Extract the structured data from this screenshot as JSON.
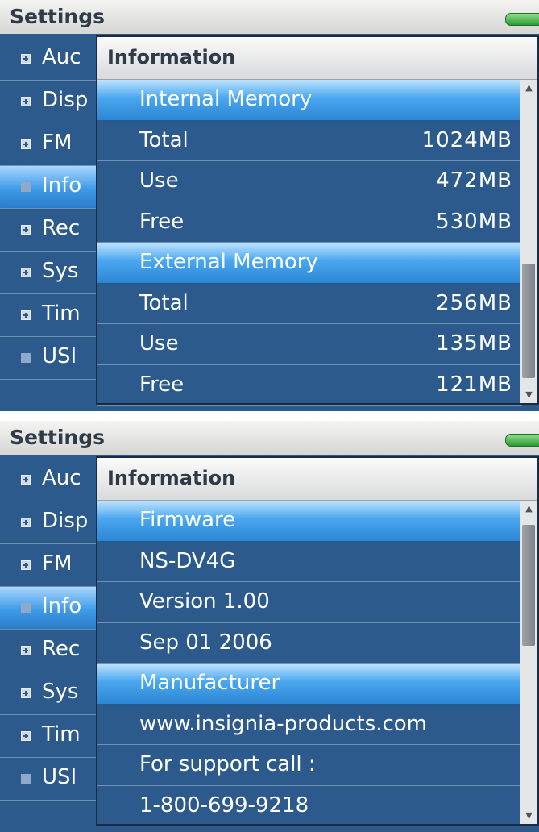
{
  "screens": [
    {
      "header": {
        "title": "Settings"
      },
      "menu": [
        "Auc",
        "Disp",
        "FM",
        "Info",
        "Rec",
        "Sys",
        "Tim",
        "USI"
      ],
      "popup": {
        "title": "Information",
        "sections": [
          {
            "heading": "Internal Memory",
            "rows": [
              {
                "label": "Total",
                "value": "1024MB"
              },
              {
                "label": "Use",
                "value": "472MB"
              },
              {
                "label": "Free",
                "value": "530MB"
              }
            ]
          },
          {
            "heading": "External Memory",
            "rows": [
              {
                "label": "Total",
                "value": "256MB"
              },
              {
                "label": "Use",
                "value": "135MB"
              },
              {
                "label": "Free",
                "value": "121MB"
              }
            ]
          }
        ]
      }
    },
    {
      "header": {
        "title": "Settings"
      },
      "menu": [
        "Auc",
        "Disp",
        "FM",
        "Info",
        "Rec",
        "Sys",
        "Tim",
        "USI"
      ],
      "popup": {
        "title": "Information",
        "sections": [
          {
            "heading": "Firmware",
            "rows": [
              {
                "label": "NS-DV4G"
              },
              {
                "label": "Version 1.00"
              },
              {
                "label": "Sep 01 2006"
              }
            ]
          },
          {
            "heading": "Manufacturer",
            "rows": [
              {
                "label": "www.insignia-products.com"
              },
              {
                "label": "For support call :"
              },
              {
                "label": "1-800-699-9218"
              }
            ]
          }
        ]
      }
    }
  ],
  "colors": {
    "background": "#2c5a8d",
    "highlight": "#3e9be8",
    "header": "#d9dadb"
  },
  "icons": {
    "scroll_up": "triangle-up",
    "scroll_down": "triangle-down",
    "battery": "battery-icon",
    "expand": "plus-bullet-icon"
  }
}
